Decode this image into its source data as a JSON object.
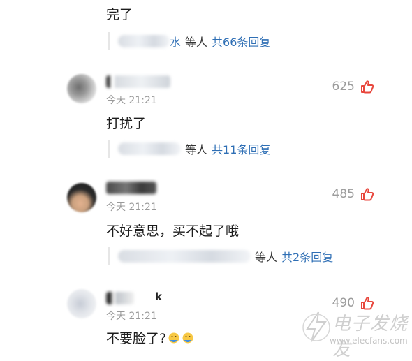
{
  "top_comment": {
    "text": "完了",
    "reply": {
      "and_text": "等人",
      "count_text": "共66条回复",
      "visible_suffix": "水"
    }
  },
  "comments": [
    {
      "time": "今天 21:21",
      "likes": "625",
      "text": "打扰了",
      "reply": {
        "and_text": "等人",
        "count_text": "共11条回复"
      }
    },
    {
      "time": "今天 21:21",
      "likes": "485",
      "text": "不好意思，买不起了哦",
      "reply": {
        "and_text": "等人",
        "count_text": "共2条回复"
      }
    },
    {
      "time": "今天 21:21",
      "likes": "490",
      "text": "不要脸了?",
      "username_tail": "k"
    }
  ],
  "colors": {
    "reply_link": "#2f6fb5",
    "like_icon": "#e8463c",
    "muted": "#9c9c9c"
  },
  "icons": {
    "like": "thumbs-up-icon",
    "emoji": "face-emoji-icon"
  },
  "watermark": {
    "title": "电子发烧友",
    "url": "www.elecfans.com"
  }
}
